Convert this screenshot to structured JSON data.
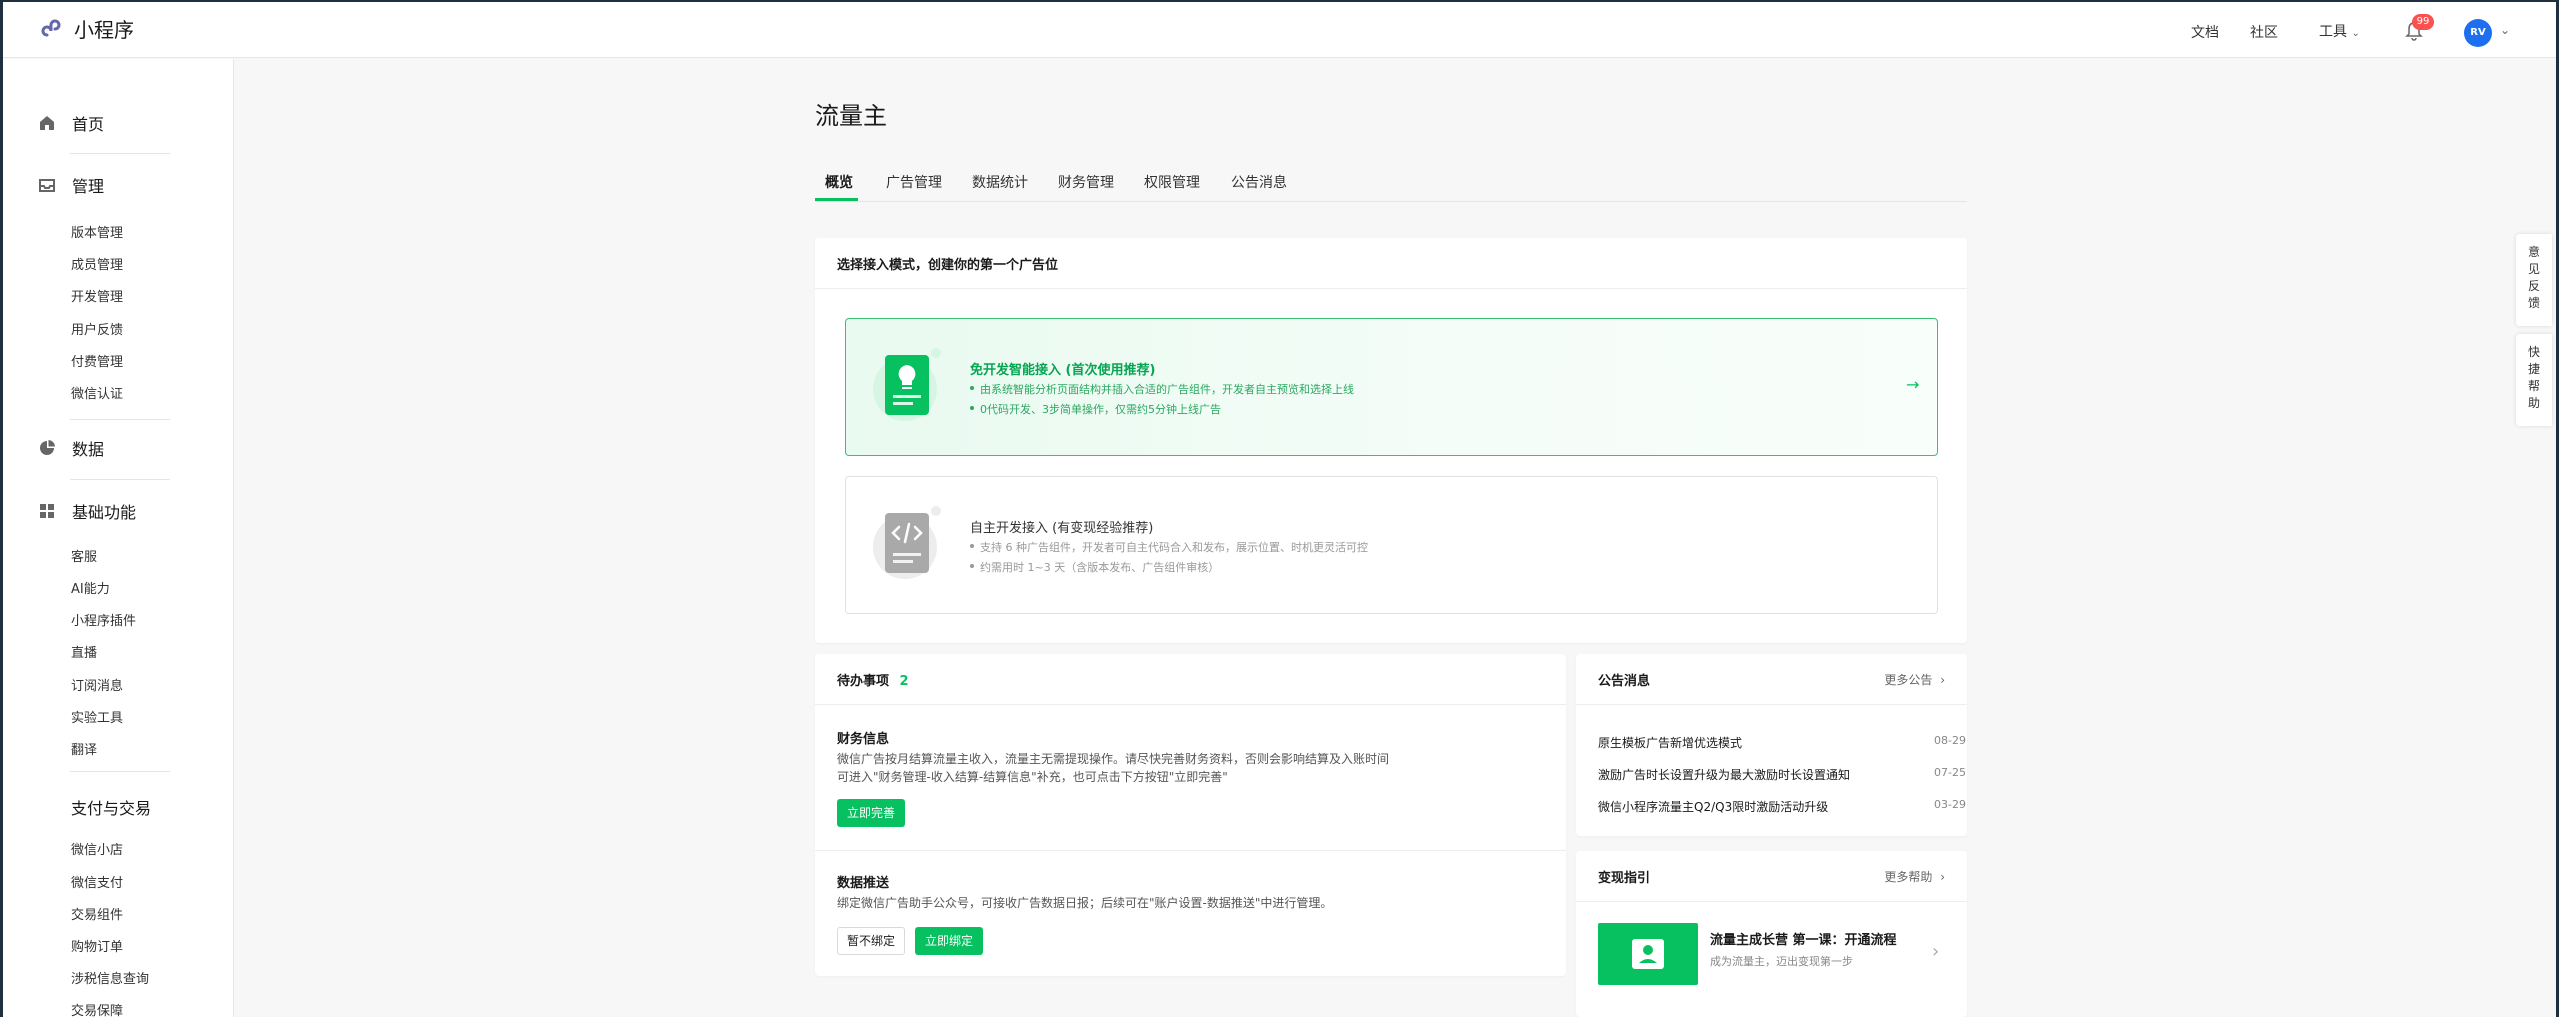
{
  "topbar": {
    "brand": "小程序",
    "links": [
      "文档",
      "社区"
    ],
    "tools_label": "工具",
    "notification_count": "99",
    "avatar_text": "RV"
  },
  "sidebar": {
    "home": "首页",
    "manage": {
      "label": "管理",
      "items": [
        "版本管理",
        "成员管理",
        "开发管理",
        "用户反馈",
        "付费管理",
        "微信认证"
      ]
    },
    "data": "数据",
    "basic": {
      "label": "基础功能",
      "items": [
        "客服",
        "AI能力",
        "小程序插件",
        "直播",
        "订阅消息",
        "实验工具",
        "翻译"
      ]
    },
    "payment": {
      "label": "支付与交易",
      "items": [
        "微信小店",
        "微信支付",
        "交易组件",
        "购物订单",
        "涉税信息查询",
        "交易保障"
      ]
    }
  },
  "page": {
    "title": "流量主",
    "tabs": [
      "概览",
      "广告管理",
      "数据统计",
      "财务管理",
      "权限管理",
      "公告消息"
    ],
    "active_tab": "概览"
  },
  "mode_card": {
    "title": "选择接入模式，创建你的第一个广告位",
    "smart": {
      "title": "免开发智能接入 (首次使用推荐)",
      "items": [
        "由系统智能分析页面结构并插入合适的广告组件，开发者自主预览和选择上线",
        "0代码开发、3步简单操作，仅需约5分钟上线广告"
      ]
    },
    "manual": {
      "title": "自主开发接入 (有变现经验推荐)",
      "items": [
        "支持 6 种广告组件，开发者可自主代码合入和发布，展示位置、时机更灵活可控",
        "约需用时 1~3 天（含版本发布、广告组件审核）"
      ]
    }
  },
  "todo": {
    "title": "待办事项",
    "count": "2",
    "finance": {
      "title": "财务信息",
      "desc_line1": "微信广告按月结算流量主收入，流量主无需提现操作。请尽快完善财务资料，否则会影响结算及入账时间",
      "desc_line2": "可进入\"财务管理-收入结算-结算信息\"补充，也可点击下方按钮\"立即完善\"",
      "button": "立即完善"
    },
    "push": {
      "title": "数据推送",
      "desc": "绑定微信广告助手公众号，可接收广告数据日报；后续可在\"账户设置-数据推送\"中进行管理。",
      "btn_skip": "暂不绑定",
      "btn_bind": "立即绑定"
    }
  },
  "announcements": {
    "title": "公告消息",
    "more": "更多公告",
    "items": [
      {
        "text": "原生模板广告新增优选模式",
        "date": "08-29"
      },
      {
        "text": "激励广告时长设置升级为最大激励时长设置通知",
        "date": "07-25"
      },
      {
        "text": "微信小程序流量主Q2/Q3限时激励活动升级",
        "date": "03-29"
      }
    ]
  },
  "guide": {
    "title": "变现指引",
    "more": "更多帮助",
    "course_title": "流量主成长营 第一课：开通流程",
    "course_sub": "成为流量主，迈出变现第一步"
  },
  "floating": {
    "feedback": "意见反馈",
    "help": "快捷帮助"
  },
  "colors": {
    "primary": "#07c160",
    "badge": "#fa5151",
    "avatar": "#1e6ff0"
  }
}
